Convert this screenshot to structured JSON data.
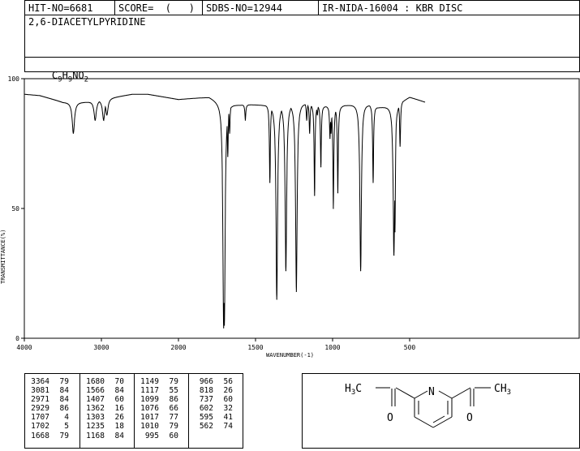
{
  "header": {
    "hit_no": "HIT-NO=6681",
    "score": "SCORE=  (   )",
    "sdbs_no": "SDBS-NO=12944",
    "method": "IR-NIDA-16004 : KBR DISC"
  },
  "compound_name": "2,6-DIACETYLPYRIDINE",
  "formula": {
    "c": "C",
    "c_n": "9",
    "h": "H",
    "h_n": "9",
    "rest": "NO",
    "o_n": "2"
  },
  "chart_data": {
    "type": "line",
    "xlabel": "WAVENUMBER(-1)",
    "ylabel": "TRANSMITTANCE(%)",
    "xlim": [
      4000,
      400
    ],
    "ylim": [
      0,
      100
    ],
    "x_ticks": [
      "4000",
      "3000",
      "2000",
      "1500",
      "1000",
      "500"
    ],
    "y_ticks": [
      "100",
      "50",
      "0"
    ],
    "baseline": [
      [
        4000,
        94
      ],
      [
        3800,
        93.5
      ],
      [
        3500,
        91
      ],
      [
        3200,
        91
      ],
      [
        3000,
        92
      ],
      [
        2800,
        93
      ],
      [
        2600,
        94
      ],
      [
        2400,
        94
      ],
      [
        2200,
        93
      ],
      [
        2000,
        92
      ],
      [
        1800,
        93
      ],
      [
        1730,
        91
      ],
      [
        1600,
        90
      ],
      [
        1500,
        90
      ],
      [
        1400,
        90
      ],
      [
        1200,
        91
      ],
      [
        1100,
        90
      ],
      [
        1000,
        89
      ],
      [
        900,
        90
      ],
      [
        800,
        91
      ],
      [
        700,
        89
      ],
      [
        600,
        90
      ],
      [
        500,
        93
      ],
      [
        400,
        91
      ]
    ],
    "peaks": [
      {
        "x": 3364,
        "y": 79
      },
      {
        "x": 3081,
        "y": 84
      },
      {
        "x": 2971,
        "y": 84
      },
      {
        "x": 2929,
        "y": 86
      },
      {
        "x": 1707,
        "y": 4
      },
      {
        "x": 1702,
        "y": 5
      },
      {
        "x": 1668,
        "y": 79
      },
      {
        "x": 1680,
        "y": 70
      },
      {
        "x": 1566,
        "y": 84
      },
      {
        "x": 1407,
        "y": 60
      },
      {
        "x": 1362,
        "y": 15
      },
      {
        "x": 1303,
        "y": 26
      },
      {
        "x": 1235,
        "y": 18
      },
      {
        "x": 1168,
        "y": 84
      },
      {
        "x": 1149,
        "y": 79
      },
      {
        "x": 1117,
        "y": 55
      },
      {
        "x": 1099,
        "y": 86
      },
      {
        "x": 1076,
        "y": 66
      },
      {
        "x": 1017,
        "y": 77
      },
      {
        "x": 1010,
        "y": 79
      },
      {
        "x": 995,
        "y": 50
      },
      {
        "x": 966,
        "y": 56
      },
      {
        "x": 818,
        "y": 26
      },
      {
        "x": 737,
        "y": 60
      },
      {
        "x": 602,
        "y": 32
      },
      {
        "x": 595,
        "y": 41
      },
      {
        "x": 562,
        "y": 74
      }
    ]
  },
  "peak_table": {
    "columns": [
      {
        "wn": [
          "3364",
          "3081",
          "2971",
          "2929",
          "1707",
          "1702",
          "1668"
        ],
        "t": [
          "79",
          "84",
          "84",
          "86",
          "4",
          "5",
          "79"
        ]
      },
      {
        "wn": [
          "1680",
          "1566",
          "1407",
          "1362",
          "1303",
          "1235",
          "1168"
        ],
        "t": [
          "70",
          "84",
          "60",
          "16",
          "26",
          "18",
          "84"
        ]
      },
      {
        "wn": [
          "1149",
          "1117",
          "1099",
          "1076",
          "1017",
          "1010",
          "995"
        ],
        "t": [
          "79",
          "55",
          "86",
          "66",
          "77",
          "79",
          "60"
        ]
      },
      {
        "wn": [
          "966",
          "818",
          "737",
          "602",
          "595",
          "562",
          ""
        ],
        "t": [
          "56",
          "26",
          "60",
          "32",
          "41",
          "74",
          ""
        ]
      }
    ]
  },
  "structure": {
    "left_group": {
      "h": "H",
      "h_n": "3",
      "c": "C"
    },
    "right_group": {
      "c": "CH",
      "h_n": "3"
    },
    "nitrogen": "N",
    "oxygen_left": "O",
    "oxygen_right": "O"
  }
}
